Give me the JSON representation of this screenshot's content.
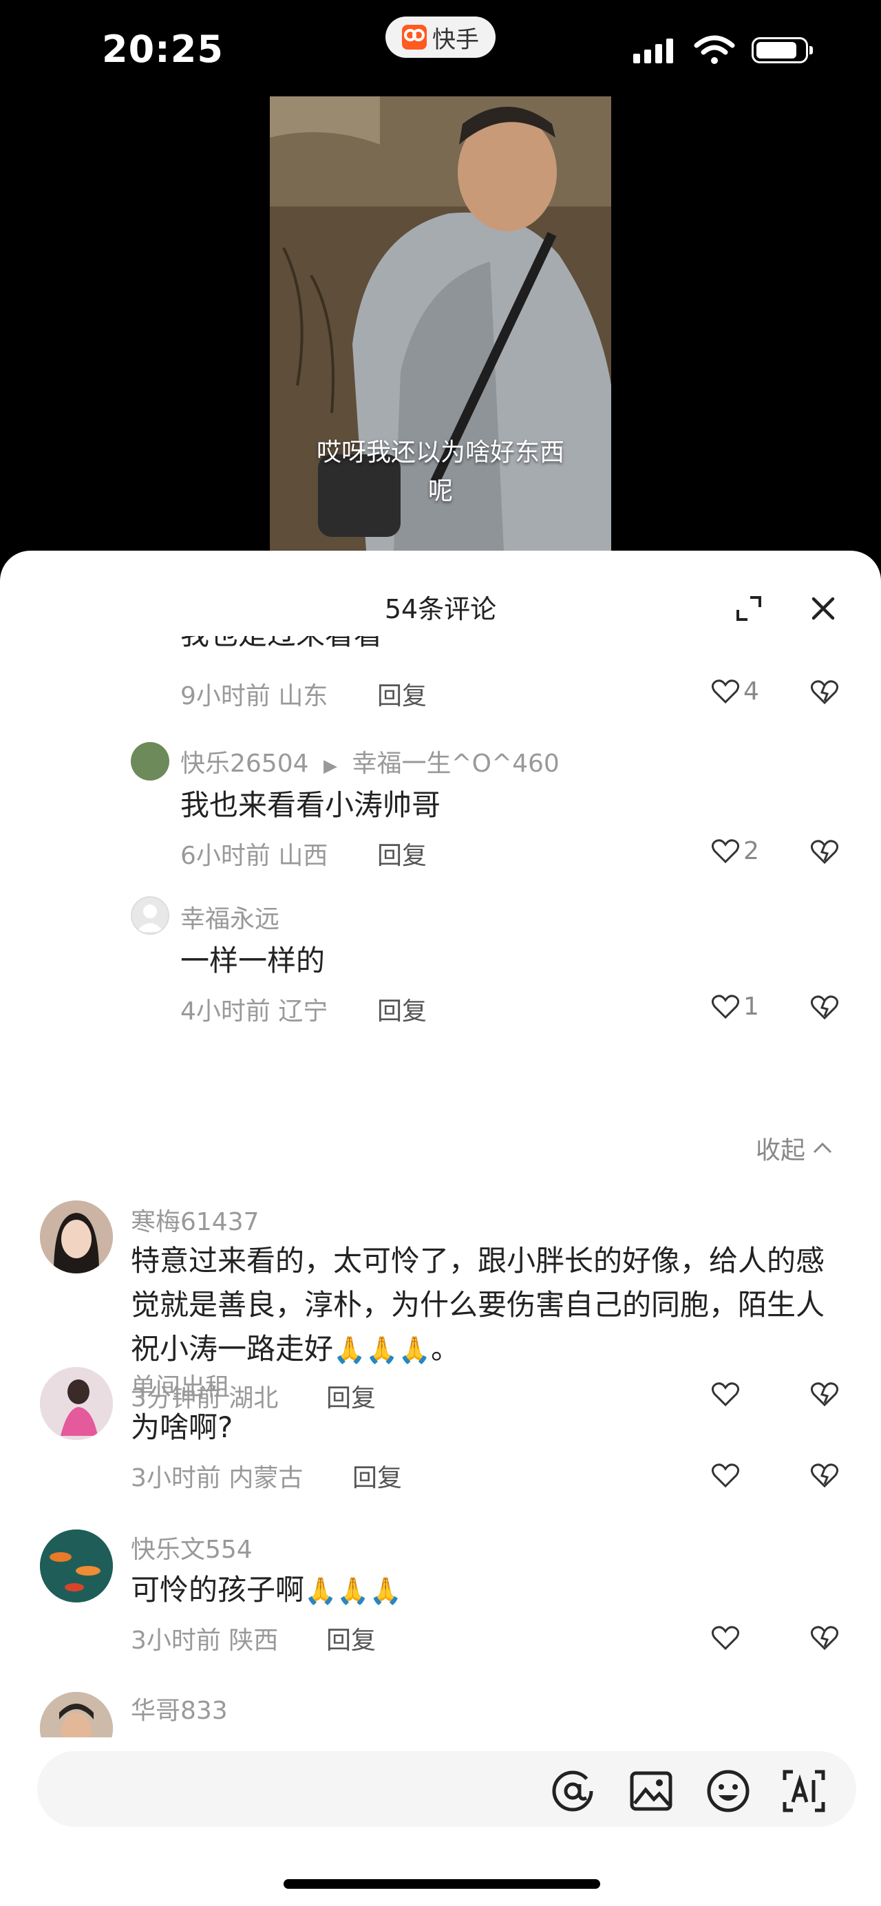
{
  "status_bar": {
    "time": "20:25",
    "app_name": "快手"
  },
  "video": {
    "subtitle": "哎呀我还以为啥好东西\n呢"
  },
  "sheet": {
    "title": "54条评论"
  },
  "comments": [
    {
      "text": "我也是过来看看",
      "meta": "9小时前 山东",
      "reply": "回复",
      "likes": "4"
    },
    {
      "name": "快乐26504",
      "reply_to": "幸福一生^O^460",
      "text": "我也来看看小涛帅哥",
      "meta": "6小时前 山西",
      "reply": "回复",
      "likes": "2"
    },
    {
      "name": "幸福永远",
      "text": "一样一样的",
      "meta": "4小时前 辽宁",
      "reply": "回复",
      "likes": "1"
    },
    {
      "name": "寒梅61437",
      "text": "特意过来看的，太可怜了，跟小胖长的好像，给人的感觉就是善良，淳朴，为什么要伤害自己的同胞，陌生人祝小涛一路走好",
      "text_end": "。",
      "meta": "3分钟前 湖北",
      "reply": "回复"
    },
    {
      "name": "单间出租",
      "text": "为啥啊?",
      "meta": "3小时前 内蒙古",
      "reply": "回复"
    },
    {
      "name": "快乐文554",
      "text": "可怜的孩子啊",
      "meta": "3小时前 陕西",
      "reply": "回复"
    },
    {
      "name": "华哥833"
    }
  ],
  "collapse_label": "收起",
  "icons": {
    "at": "at-icon",
    "image": "image-icon",
    "emoji": "emoji-icon",
    "ai": "ai-icon",
    "like": "heart-icon",
    "dislike": "broken-heart-icon",
    "expand": "expand-icon",
    "close": "close-icon"
  },
  "colors": {
    "brand": "#ff5a1f",
    "muted": "#999999",
    "text": "#222222"
  }
}
